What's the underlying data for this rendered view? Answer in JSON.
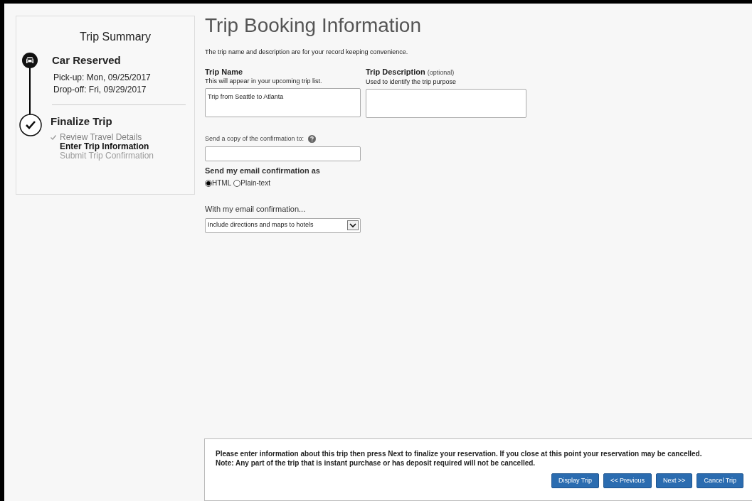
{
  "sidebar": {
    "title": "Trip Summary",
    "steps": [
      {
        "kind": "car",
        "title": "Car Reserved",
        "lines": [
          "Pick-up: Mon, 09/25/2017",
          "Drop-off: Fri, 09/29/2017"
        ]
      },
      {
        "kind": "check",
        "title": "Finalize Trip",
        "substeps": [
          {
            "label": "Review Travel Details",
            "done": true,
            "current": false
          },
          {
            "label": "Enter Trip Information",
            "done": false,
            "current": true
          },
          {
            "label": "Submit Trip Confirmation",
            "done": false,
            "current": false
          }
        ]
      }
    ]
  },
  "main": {
    "title": "Trip Booking Information",
    "intro": "The trip name and description are for your record keeping convenience.",
    "trip_name": {
      "label": "Trip Name",
      "hint": "This will appear in your upcoming trip list.",
      "value": "Trip from Seattle to Atlanta"
    },
    "trip_description": {
      "label": "Trip Description",
      "optional": "(optional)",
      "hint": "Used to identify the trip purpose"
    },
    "copy_to": {
      "label": "Send a copy of the confirmation to:"
    },
    "format": {
      "label": "Send my email confirmation as",
      "options": [
        {
          "label": "HTML",
          "selected": true
        },
        {
          "label": "Plain-text",
          "selected": false
        }
      ]
    },
    "extras": {
      "label": "With my email confirmation...",
      "value": "Include directions and maps to hotels"
    }
  },
  "footer": {
    "message": "Please enter information about this trip then press Next to finalize your reservation. If you close at this point your reservation may be cancelled.",
    "note": "Note: Any part of the trip that is instant purchase or has deposit required will not be cancelled.",
    "buttons": [
      "Display Trip",
      "<< Previous",
      "Next >>",
      "Cancel Trip"
    ]
  }
}
